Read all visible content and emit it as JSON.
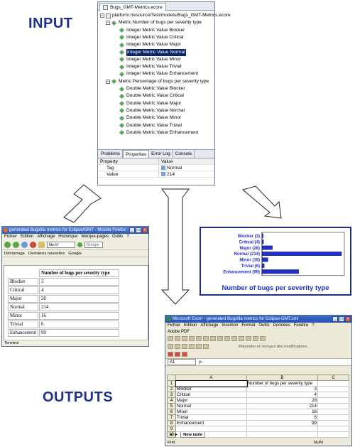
{
  "headings": {
    "input": "INPUT",
    "outputs": "OUTPUTS"
  },
  "eclipse": {
    "tab": "Bugs_GMT-Metrics.ecore",
    "resource": "platform:/resource/Test/models/Bugs_GMT-Metrics.ecore",
    "metric1": "Metric Number of bugs per severity type",
    "metric1_items": [
      "Integer Metric Value Blocker",
      "Integer Metric Value Critical",
      "Integer Metric Value Major",
      "Integer Metric Value Normal",
      "Integer Metric Value Minor",
      "Integer Metric Value Trivial",
      "Integer Metric Value Enhancement"
    ],
    "metric2": "Metric Percentage of bugs per severity type",
    "metric2_items": [
      "Double Metric Value Blocker",
      "Double Metric Value Critical",
      "Double Metric Value Major",
      "Double Metric Value Normal",
      "Double Metric Value Minor",
      "Double Metric Value Trivial",
      "Double Metric Value Enhancement"
    ],
    "view_tabs": [
      "Problems",
      "Properties",
      "Error Log",
      "Console"
    ],
    "props_header": [
      "Property",
      "Value"
    ],
    "props_rows": [
      [
        "Tag",
        "Normal"
      ],
      [
        "Value",
        "214"
      ]
    ]
  },
  "firefox": {
    "title": "generated Bugzilla metrics for Eclipse/GMT - Mozilla Firefox",
    "menu": [
      "Fichier",
      "Édition",
      "Affichage",
      "Historique",
      "Marque-pages",
      "Outils",
      "?"
    ],
    "url": "file:///",
    "search_placeholder": "Google",
    "bookmarks": [
      "Démarrage",
      "Dernières nouvelles",
      "Google"
    ],
    "table_header": "Number of bugs per severity type",
    "rows": [
      [
        "Blocker",
        "3"
      ],
      [
        "Critical",
        "4"
      ],
      [
        "Major",
        "28"
      ],
      [
        "Normal",
        "214"
      ],
      [
        "Minor",
        "16"
      ],
      [
        "Trivial",
        "6"
      ],
      [
        "Enhancement",
        "99"
      ]
    ],
    "status": "Terminé"
  },
  "chart_data": {
    "type": "bar",
    "orientation": "horizontal",
    "categories": [
      "Blocker (3)",
      "Critical (4)",
      "Major (28)",
      "Normal (214)",
      "Minor (16)",
      "Trivial (6)",
      "Enhancement (99)"
    ],
    "values": [
      3,
      4,
      28,
      214,
      16,
      6,
      99
    ],
    "title": "Number of bugs per severity type",
    "xlim": [
      0,
      214
    ],
    "bar_color": "#1f2fcf",
    "grid": false,
    "legend": "none"
  },
  "excel": {
    "title": "Microsoft Excel - generated Bugzilla metrics for Eclipse-GMT.xml",
    "menu": [
      "Fichier",
      "Edition",
      "Affichage",
      "Insertion",
      "Format",
      "Outils",
      "Données",
      "Fenêtre",
      "?"
    ],
    "adobe": "Adobe PDF",
    "reply_text": "Répondre en incluant des modifications...",
    "name_box": "A1",
    "fx": "fx",
    "columns": [
      "A",
      "B",
      "C"
    ],
    "header_cell": "Number of bugs per severity type",
    "rows": [
      [
        "Blocker",
        "3"
      ],
      [
        "Critical",
        "4"
      ],
      [
        "Major",
        "28"
      ],
      [
        "Normal",
        "214"
      ],
      [
        "Minor",
        "16"
      ],
      [
        "Trivial",
        "6"
      ],
      [
        "Enhancement",
        "99"
      ]
    ],
    "sheet_tab": "New table",
    "status_left": "Prêt",
    "status_right": "NUM"
  }
}
